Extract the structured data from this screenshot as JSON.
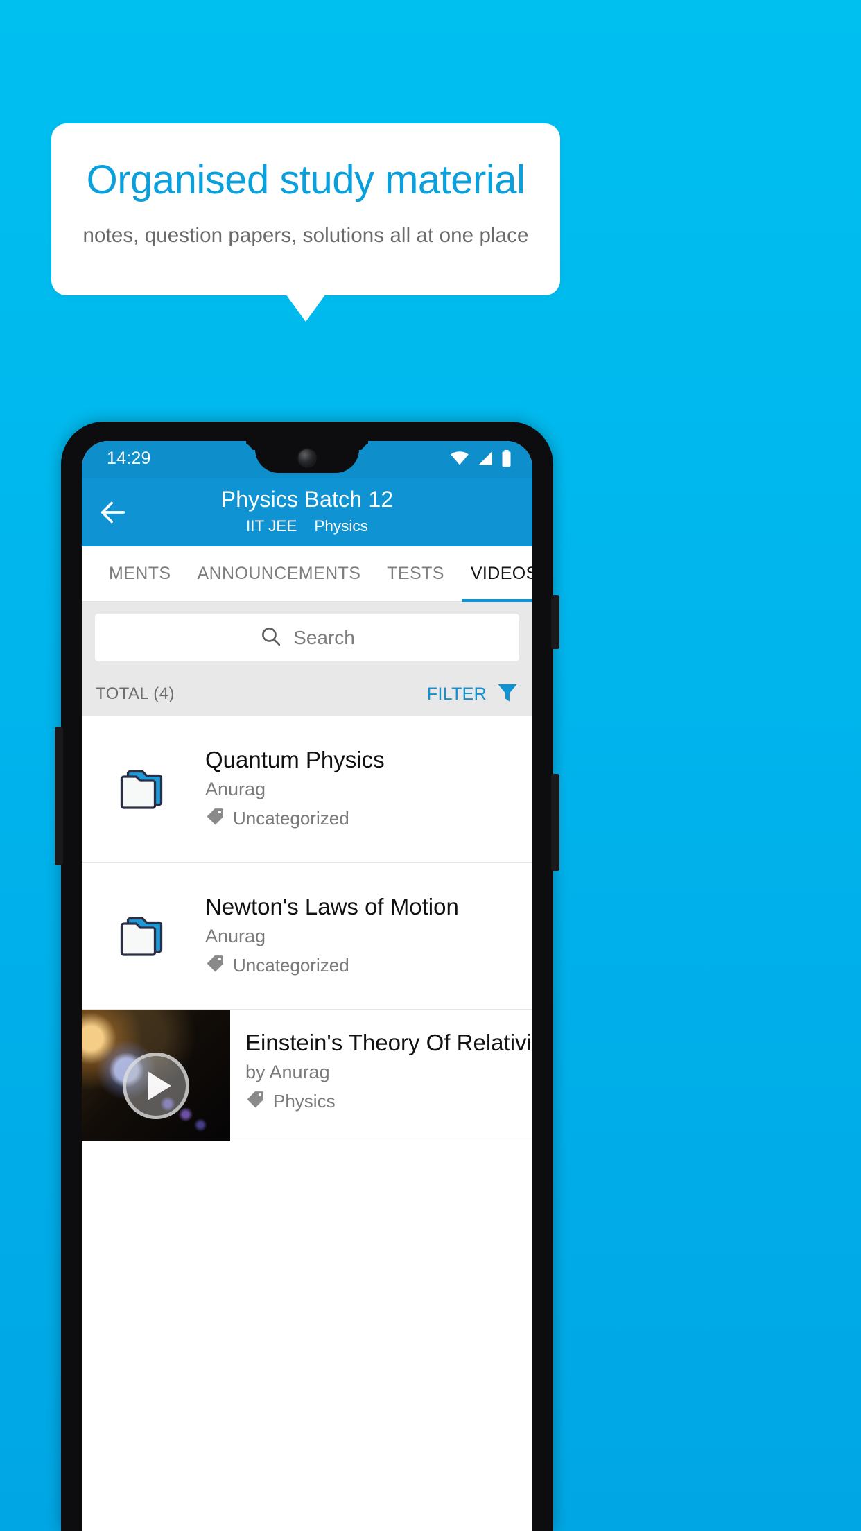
{
  "promo": {
    "title": "Organised study material",
    "subtitle": "notes, question papers, solutions all at one place",
    "accent_color": "#0b9fdc",
    "background_top": "#00c0f0",
    "background_bottom": "#00a6e4"
  },
  "phone": {
    "statusbar": {
      "time": "14:29",
      "icons": [
        "wifi-icon",
        "signal-icon",
        "battery-icon"
      ],
      "background_color": "#0e8fcc"
    },
    "appbar": {
      "back_icon": "back-arrow-icon",
      "title": "Physics Batch 12",
      "subtitle_exam": "IIT JEE",
      "subtitle_subject": "Physics",
      "background_color": "#0f93d2"
    },
    "tabs": [
      {
        "label": "MENTS",
        "active": false
      },
      {
        "label": "ANNOUNCEMENTS",
        "active": false
      },
      {
        "label": "TESTS",
        "active": false
      },
      {
        "label": "VIDEOS",
        "active": true
      }
    ],
    "search": {
      "placeholder": "Search",
      "value": "",
      "icon": "search-icon"
    },
    "toolbar": {
      "total_label": "TOTAL (4)",
      "filter_label": "FILTER",
      "filter_icon": "filter-funnel-icon",
      "filter_color": "#0f93d2"
    },
    "items": [
      {
        "type": "folder",
        "icon": "folder-stack-icon",
        "title": "Quantum Physics",
        "author": "Anurag",
        "tag_icon": "tag-icon",
        "tag": "Uncategorized"
      },
      {
        "type": "folder",
        "icon": "folder-stack-icon",
        "title": "Newton's Laws of Motion",
        "author": "Anurag",
        "tag_icon": "tag-icon",
        "tag": "Uncategorized"
      },
      {
        "type": "video",
        "icon": "video-thumbnail",
        "play_icon": "play-icon",
        "title": "Einstein's Theory Of Relativity",
        "author": "by Anurag",
        "tag_icon": "tag-icon",
        "tag": "Physics"
      }
    ]
  }
}
